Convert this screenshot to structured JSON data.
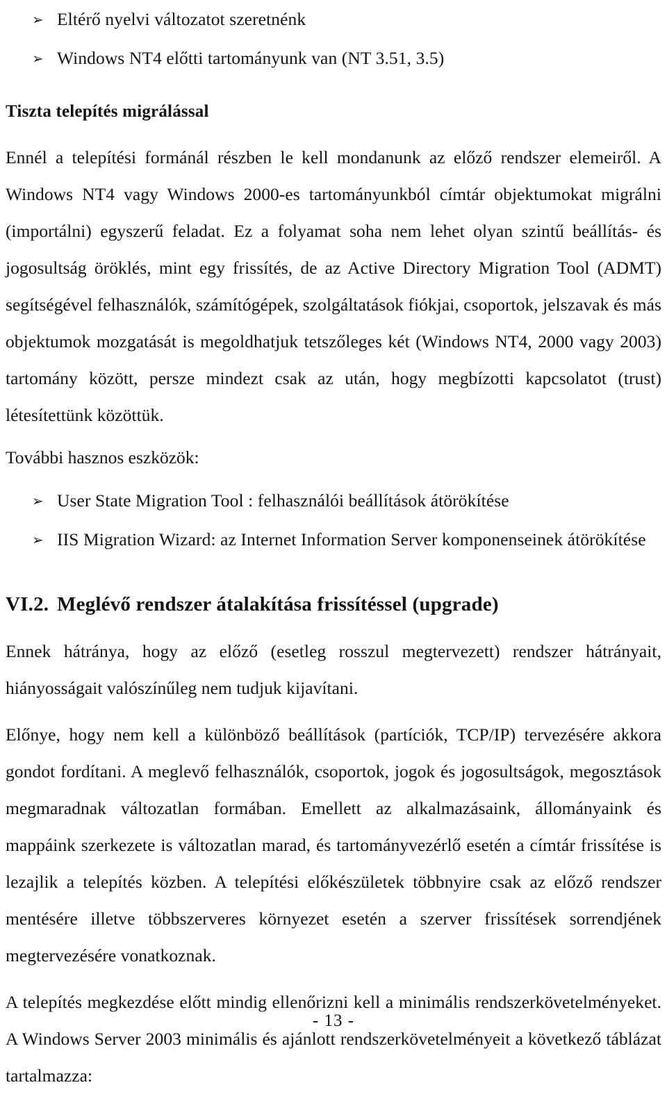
{
  "document": {
    "language": "hu",
    "page_number_label": "- 13 -",
    "bullet_glyph": "➢",
    "text_color": "#141414",
    "background_color": "#ffffff"
  },
  "top_bullets": [
    {
      "text": "Eltérő nyelvi változatot szeretnénk"
    },
    {
      "text": "Windows NT4 előtti tartományunk van (NT 3.51, 3.5)"
    }
  ],
  "clean_install_section": {
    "heading": "Tiszta telepítés migrálással",
    "paragraph": "Ennél a telepítési formánál részben le kell mondanunk az előző rendszer elemeiről. A Windows NT4 vagy Windows 2000-es tartományunkból címtár objektumokat migrálni (importálni) egyszerű feladat. Ez a folyamat soha nem lehet olyan szintű beállítás- és jogosultság öröklés, mint egy frissítés, de az Active Directory Migration Tool (ADMT) segítségével felhasználók, számítógépek, szolgáltatások fiókjai, csoportok, jelszavak és más objektumok mozgatását is megoldhatjuk tetszőleges két (Windows NT4, 2000 vagy 2003) tartomány között, persze mindezt csak az után, hogy megbízotti kapcsolatot (trust) létesítettünk közöttük.",
    "tools_label": "További hasznos eszközök:",
    "tools": [
      {
        "text": "User State Migration Tool : felhasználói beállítások átörökítése"
      },
      {
        "text": "IIS Migration Wizard: az Internet Information Server komponenseinek átörökítése"
      }
    ]
  },
  "upgrade_section": {
    "heading_number": "VI.2.",
    "heading_title": "Meglévő rendszer átalakítása frissítéssel (upgrade)",
    "paragraphs": [
      "Ennek hátránya, hogy az előző (esetleg rosszul megtervezett) rendszer hátrányait, hiányosságait valószínűleg nem tudjuk kijavítani.",
      "Előnye, hogy nem kell a különböző beállítások (partíciók, TCP/IP) tervezésére akkora gondot fordítani. A meglevő felhasználók, csoportok, jogok és jogosultságok, megosztások megmaradnak változatlan formában. Emellett az alkalmazásaink, állományaink és mappáink szerkezete is változatlan marad, és tartományvezérlő esetén a címtár frissítése is lezajlik a telepítés közben. A telepítési előkészületek többnyire csak az előző rendszer mentésére illetve többszerveres környezet esetén a szerver frissítések sorrendjének megtervezésére vonatkoznak.",
      "A telepítés megkezdése előtt mindig ellenőrizni kell a minimális rendszerkövetelményeket. A Windows Server 2003 minimális és ajánlott rendszerkövetelményeit a következő táblázat tartalmazza:"
    ]
  }
}
